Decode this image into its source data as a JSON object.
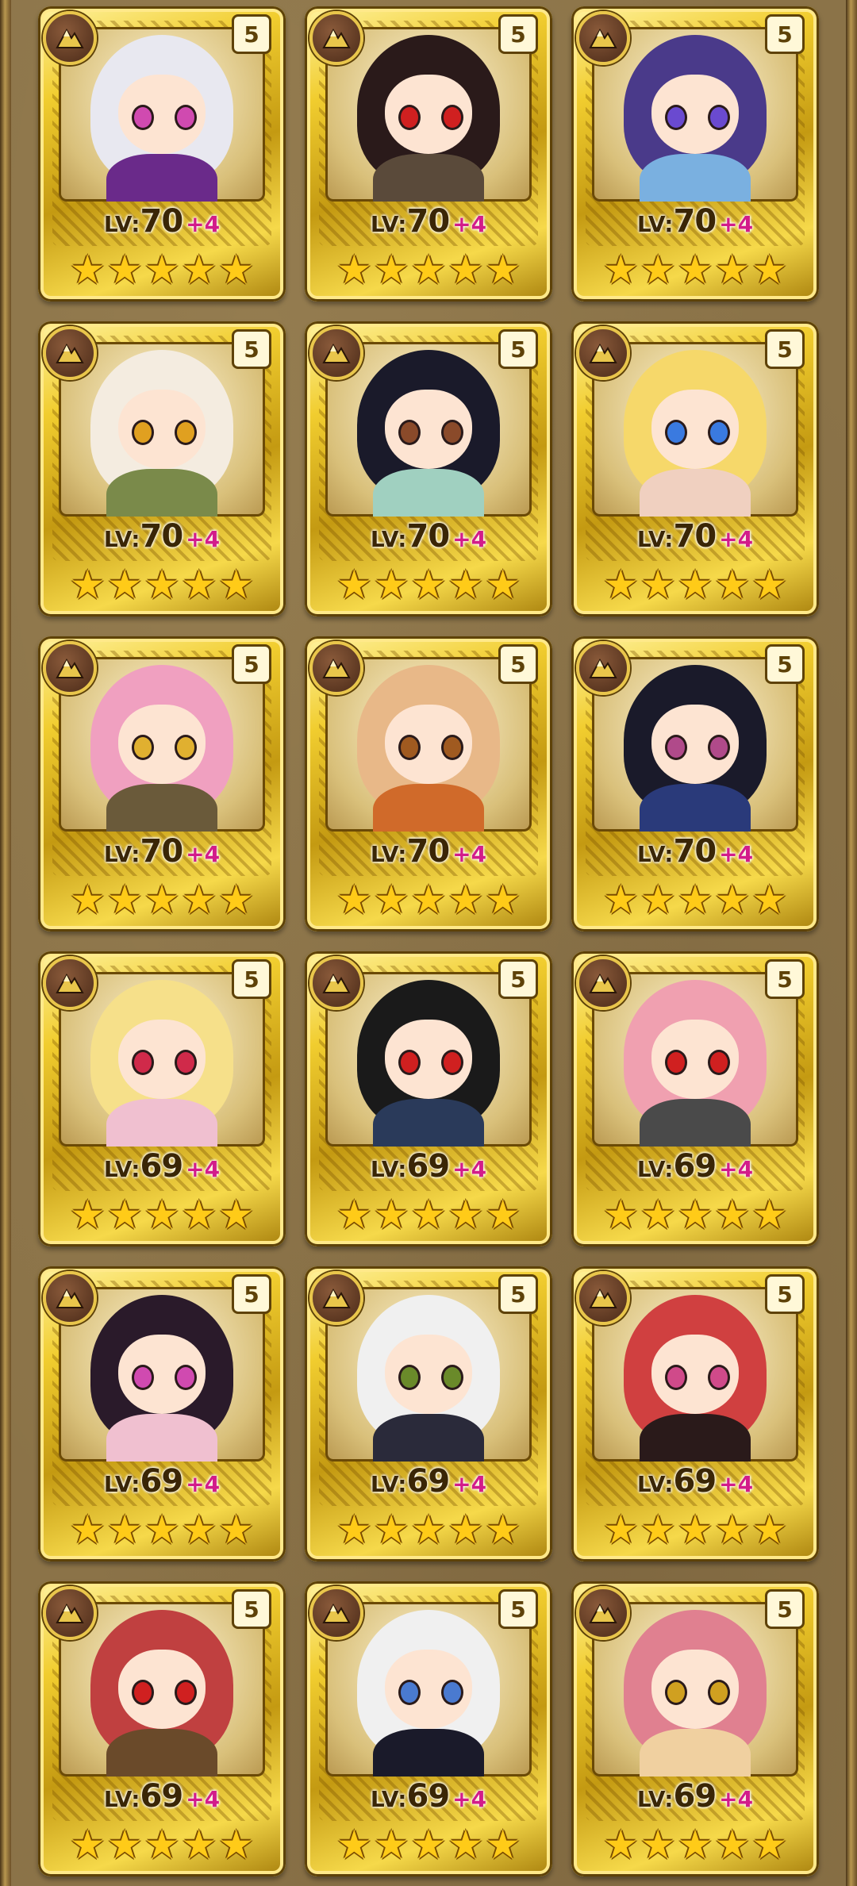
{
  "colors": {
    "background": "#8b7348",
    "frame_gold": "#f1cd2f",
    "level_text": "#3a2606",
    "bonus_text": "#d21c8a",
    "star": "#ffcb18"
  },
  "icons": {
    "rank": "mountain-rank-icon",
    "star": "star-icon"
  },
  "cards": [
    {
      "grade": "5",
      "level_prefix": "LV:",
      "level": "70",
      "bonus": "+4",
      "stars": 5,
      "hair": "#e8e8f0",
      "eye": "#d04ab0",
      "outfit": "#6a2a8a"
    },
    {
      "grade": "5",
      "level_prefix": "LV:",
      "level": "70",
      "bonus": "+4",
      "stars": 5,
      "hair": "#2a1a1a",
      "eye": "#d02020",
      "outfit": "#5a4a3a"
    },
    {
      "grade": "5",
      "level_prefix": "LV:",
      "level": "70",
      "bonus": "+4",
      "stars": 5,
      "hair": "#4a3a8a",
      "eye": "#6a4ad0",
      "outfit": "#7ab0e0"
    },
    {
      "grade": "5",
      "level_prefix": "LV:",
      "level": "70",
      "bonus": "+4",
      "stars": 5,
      "hair": "#f4ece0",
      "eye": "#e0a020",
      "outfit": "#7a8a4a"
    },
    {
      "grade": "5",
      "level_prefix": "LV:",
      "level": "70",
      "bonus": "+4",
      "stars": 5,
      "hair": "#1a1a2a",
      "eye": "#8a4a2a",
      "outfit": "#a0d0c0"
    },
    {
      "grade": "5",
      "level_prefix": "LV:",
      "level": "70",
      "bonus": "+4",
      "stars": 5,
      "hair": "#f6d86a",
      "eye": "#3a7ae0",
      "outfit": "#f0d0c0"
    },
    {
      "grade": "5",
      "level_prefix": "LV:",
      "level": "70",
      "bonus": "+4",
      "stars": 5,
      "hair": "#f0a0c0",
      "eye": "#e0b030",
      "outfit": "#6a5a3a"
    },
    {
      "grade": "5",
      "level_prefix": "LV:",
      "level": "70",
      "bonus": "+4",
      "stars": 5,
      "hair": "#e8b888",
      "eye": "#a05a20",
      "outfit": "#d06a2a"
    },
    {
      "grade": "5",
      "level_prefix": "LV:",
      "level": "70",
      "bonus": "+4",
      "stars": 5,
      "hair": "#1a1a2a",
      "eye": "#b04a8a",
      "outfit": "#2a3a7a"
    },
    {
      "grade": "5",
      "level_prefix": "LV:",
      "level": "69",
      "bonus": "+4",
      "stars": 5,
      "hair": "#f6e08a",
      "eye": "#d02a4a",
      "outfit": "#f0c0d0"
    },
    {
      "grade": "5",
      "level_prefix": "LV:",
      "level": "69",
      "bonus": "+4",
      "stars": 5,
      "hair": "#1a1a1a",
      "eye": "#d02020",
      "outfit": "#2a3a5a"
    },
    {
      "grade": "5",
      "level_prefix": "LV:",
      "level": "69",
      "bonus": "+4",
      "stars": 5,
      "hair": "#f0a0b0",
      "eye": "#d02020",
      "outfit": "#4a4a4a"
    },
    {
      "grade": "5",
      "level_prefix": "LV:",
      "level": "69",
      "bonus": "+4",
      "stars": 5,
      "hair": "#2a1a2a",
      "eye": "#d04ab0",
      "outfit": "#f0c0d0"
    },
    {
      "grade": "5",
      "level_prefix": "LV:",
      "level": "69",
      "bonus": "+4",
      "stars": 5,
      "hair": "#f0f0f0",
      "eye": "#6a8a2a",
      "outfit": "#2a2a3a"
    },
    {
      "grade": "5",
      "level_prefix": "LV:",
      "level": "69",
      "bonus": "+4",
      "stars": 5,
      "hair": "#d04040",
      "eye": "#d04a8a",
      "outfit": "#2a1a1a"
    },
    {
      "grade": "5",
      "level_prefix": "LV:",
      "level": "69",
      "bonus": "+4",
      "stars": 5,
      "hair": "#c04040",
      "eye": "#d02020",
      "outfit": "#6a4a2a"
    },
    {
      "grade": "5",
      "level_prefix": "LV:",
      "level": "69",
      "bonus": "+4",
      "stars": 5,
      "hair": "#f0f0f0",
      "eye": "#4a7ad0",
      "outfit": "#1a1a2a"
    },
    {
      "grade": "5",
      "level_prefix": "LV:",
      "level": "69",
      "bonus": "+4",
      "stars": 5,
      "hair": "#e08090",
      "eye": "#d0a020",
      "outfit": "#f0d0a0"
    }
  ]
}
